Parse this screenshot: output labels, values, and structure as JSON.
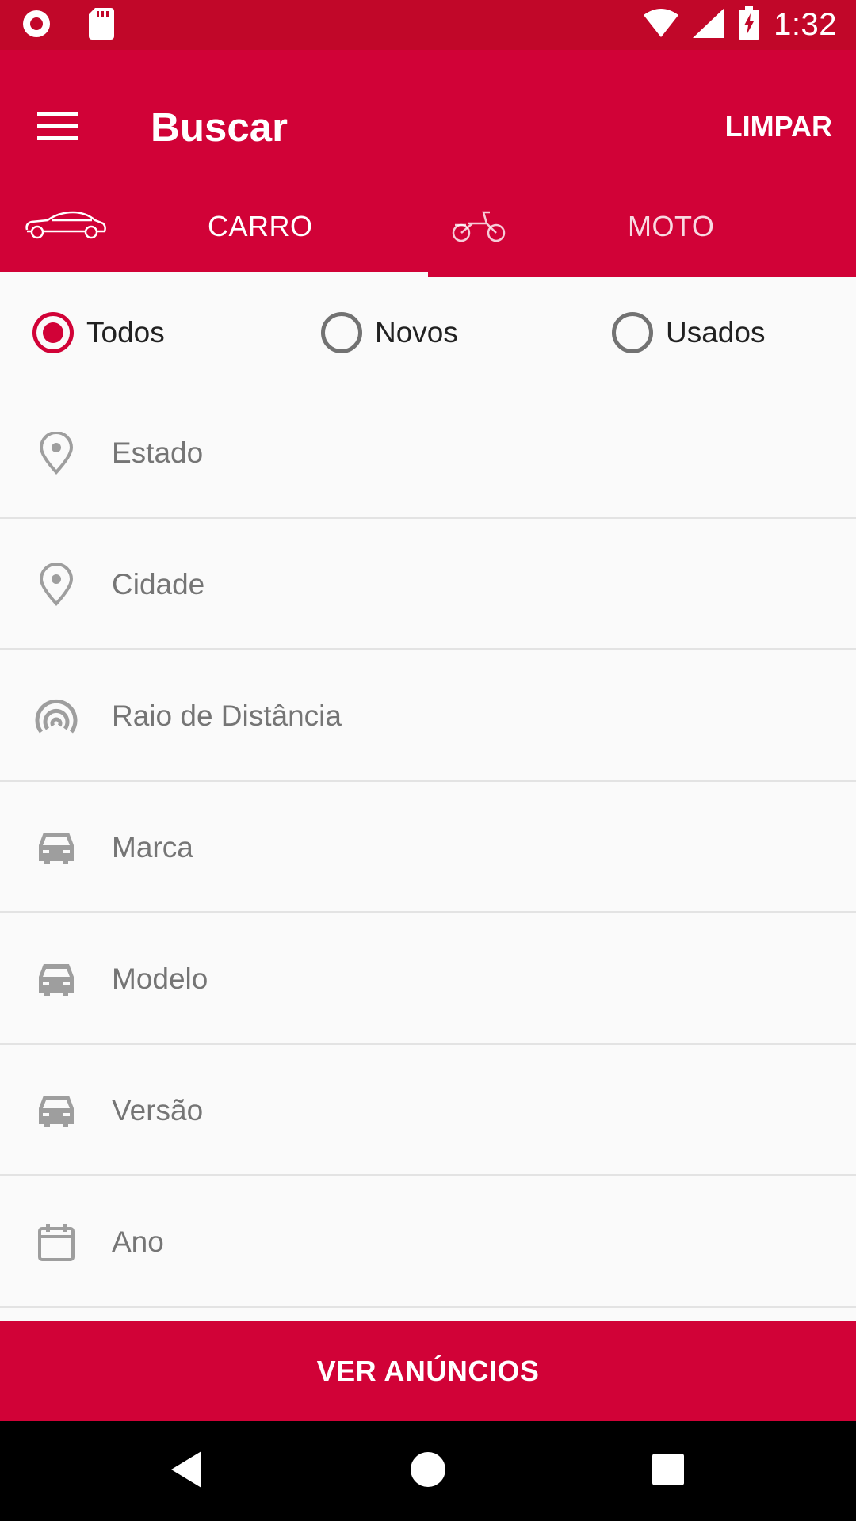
{
  "status_bar": {
    "time": "1:32",
    "icons": [
      "record-icon",
      "sd-card-icon",
      "wifi-icon",
      "signal-icon",
      "battery-charging-icon"
    ]
  },
  "app_bar": {
    "title": "Buscar",
    "clear_label": "LIMPAR",
    "menu_icon": "hamburger-menu-icon"
  },
  "tabs": [
    {
      "label": "CARRO",
      "icon": "car-icon",
      "active": true
    },
    {
      "label": "MOTO",
      "icon": "motorcycle-icon",
      "active": false
    }
  ],
  "condition_filter": {
    "options": [
      {
        "label": "Todos",
        "checked": true
      },
      {
        "label": "Novos",
        "checked": false
      },
      {
        "label": "Usados",
        "checked": false
      }
    ]
  },
  "fields": [
    {
      "label": "Estado",
      "icon": "location-pin-icon"
    },
    {
      "label": "Cidade",
      "icon": "location-pin-icon"
    },
    {
      "label": "Raio de Distância",
      "icon": "radius-signal-icon"
    },
    {
      "label": "Marca",
      "icon": "car-front-icon"
    },
    {
      "label": "Modelo",
      "icon": "car-front-icon"
    },
    {
      "label": "Versão",
      "icon": "car-front-icon"
    },
    {
      "label": "Ano",
      "icon": "calendar-icon"
    }
  ],
  "cta": {
    "label": "VER ANÚNCIOS"
  },
  "colors": {
    "primary": "#d10237",
    "status_bar": "#c10729",
    "icon_gray": "#9e9e9e",
    "text_gray": "#757575"
  },
  "system_nav": {
    "icons": [
      "back-icon",
      "home-icon",
      "recents-icon"
    ]
  }
}
